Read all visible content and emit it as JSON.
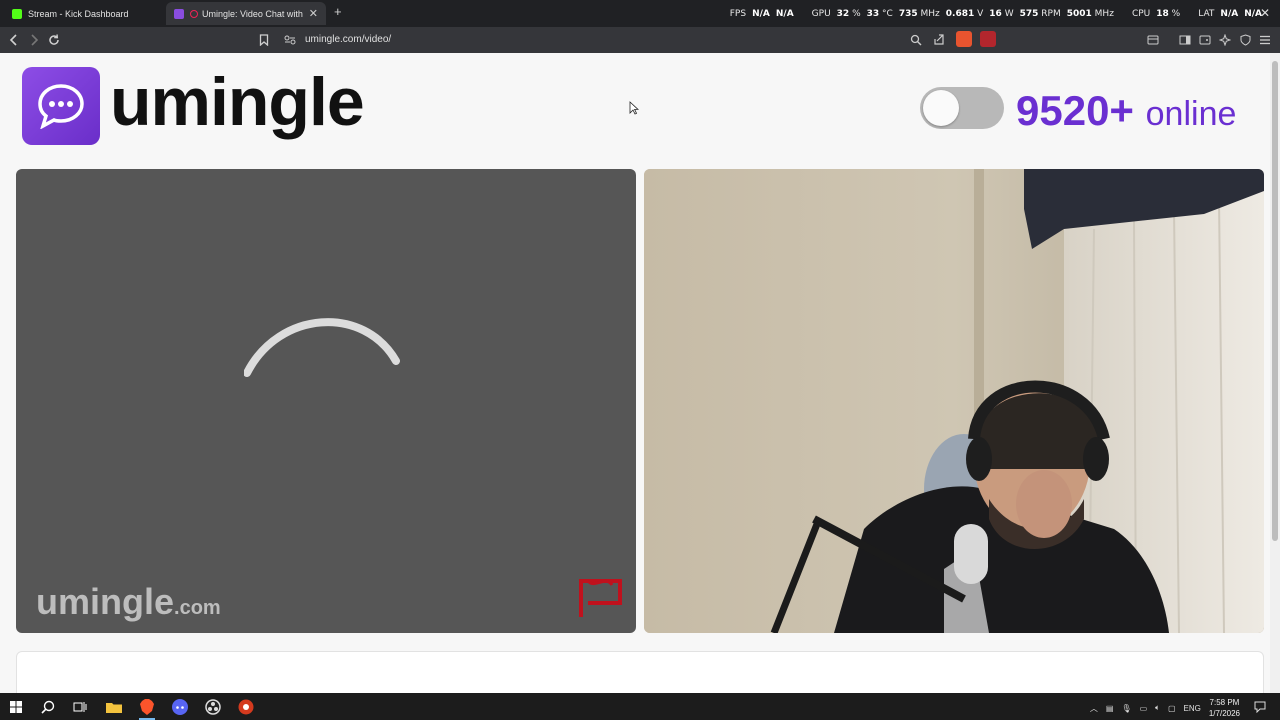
{
  "browser": {
    "tabs": [
      {
        "title": "Stream - Kick Dashboard",
        "favicon_color": "#53fc18",
        "active": false
      },
      {
        "title": "Umingle: Video Chat with Stra",
        "favicon_color": "#8a4de0",
        "active": true
      }
    ],
    "new_tab_label": "+",
    "url": "umingle.com/video/"
  },
  "osd": {
    "fps_label": "FPS",
    "fps_val1": "N/A",
    "fps_val2": "N/A",
    "gpu_label": "GPU",
    "gpu_pct": "32",
    "gpu_pct_unit": "%",
    "gpu_temp": "33",
    "gpu_temp_unit": "°C",
    "gpu_clock": "735",
    "gpu_clock_unit": "MHz",
    "gpu_volt": "0.681",
    "gpu_volt_unit": "V",
    "gpu_power": "16",
    "gpu_power_unit": "W",
    "gpu_rpm": "575",
    "gpu_rpm_unit": "RPM",
    "gpu_mem": "5001",
    "gpu_mem_unit": "MHz",
    "cpu_label": "CPU",
    "cpu_pct": "18",
    "cpu_pct_unit": "%",
    "lat_label": "LAT",
    "lat_val1": "N/A",
    "lat_val2": "N/A"
  },
  "site": {
    "brand": "umingle",
    "online_count": "9520+",
    "online_word": "online",
    "watermark_main": "umingle",
    "watermark_domain": ".com",
    "colors": {
      "accent": "#6a2fd1",
      "panel_gray": "#565656"
    }
  },
  "taskbar": {
    "lang": "ENG",
    "time": "7:58 PM",
    "date": "1/7/2026"
  }
}
